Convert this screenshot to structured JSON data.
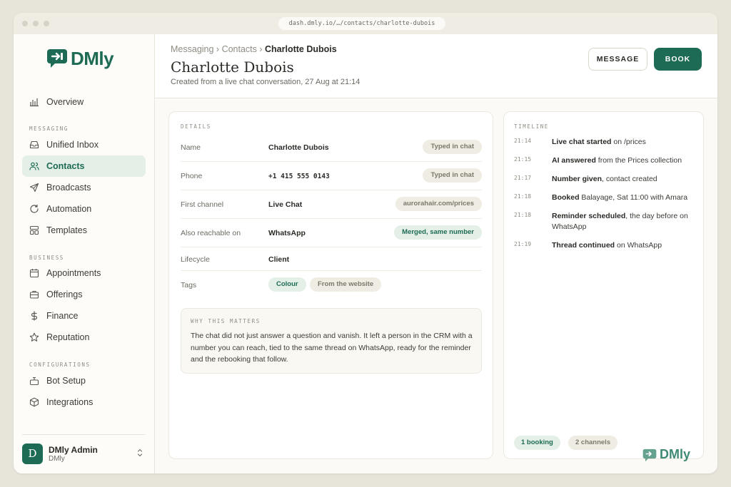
{
  "browser": {
    "url": "dash.dmly.io/…/contacts/charlotte-dubois"
  },
  "brand": {
    "name": "DMly",
    "accent": "#1d6b54"
  },
  "sidebar": {
    "overview": "Overview",
    "sections": {
      "messaging": "MESSAGING",
      "business": "BUSINESS",
      "configurations": "CONFIGURATIONS"
    },
    "items": {
      "unified_inbox": "Unified Inbox",
      "contacts": "Contacts",
      "broadcasts": "Broadcasts",
      "automation": "Automation",
      "templates": "Templates",
      "appointments": "Appointments",
      "offerings": "Offerings",
      "finance": "Finance",
      "reputation": "Reputation",
      "bot_setup": "Bot Setup",
      "integrations": "Integrations"
    },
    "user": {
      "initial": "D",
      "name": "DMly Admin",
      "org": "DMly"
    }
  },
  "header": {
    "breadcrumb": [
      "Messaging",
      "Contacts",
      "Charlotte Dubois"
    ],
    "title": "Charlotte Dubois",
    "subtitle": "Created from a live chat conversation, 27 Aug at 21:14",
    "message_button": "MESSAGE",
    "book_button": "BOOK"
  },
  "details": {
    "label": "DETAILS",
    "rows": [
      {
        "label": "Name",
        "value": "Charlotte Dubois",
        "chip": "Typed in chat"
      },
      {
        "label": "Phone",
        "value": "+1 415 555 0143",
        "chip": "Typed in chat"
      },
      {
        "label": "First channel",
        "value": "Live Chat",
        "chip": "aurorahair.com/prices"
      },
      {
        "label": "Also reachable on",
        "value": "WhatsApp",
        "chip": "Merged, same number"
      },
      {
        "label": "Lifecycle",
        "value": "Client"
      },
      {
        "label": "Tags",
        "tags": [
          "Colour",
          "From the website"
        ]
      }
    ],
    "note": {
      "label": "WHY THIS MATTERS",
      "text": "The chat did not just answer a question and vanish. It left a person in the CRM with a number you can reach, tied to the same thread on WhatsApp, ready for the reminder and the rebooking that follow."
    }
  },
  "timeline": {
    "label": "TIMELINE",
    "items": [
      {
        "time": "21:14",
        "bold": "Live chat started",
        "rest": " on /prices"
      },
      {
        "time": "21:15",
        "bold": "AI answered",
        "rest": " from the Prices collection"
      },
      {
        "time": "21:17",
        "bold": "Number given",
        "rest": ", contact created"
      },
      {
        "time": "21:18",
        "bold": "Booked",
        "rest": " Balayage, Sat 11:00 with Amara"
      },
      {
        "time": "21:18",
        "bold": "Reminder scheduled",
        "rest": ", the day before on WhatsApp"
      },
      {
        "time": "21:19",
        "bold": "Thread continued",
        "rest": " on WhatsApp"
      }
    ],
    "chips": [
      "1 booking",
      "2 channels"
    ]
  }
}
